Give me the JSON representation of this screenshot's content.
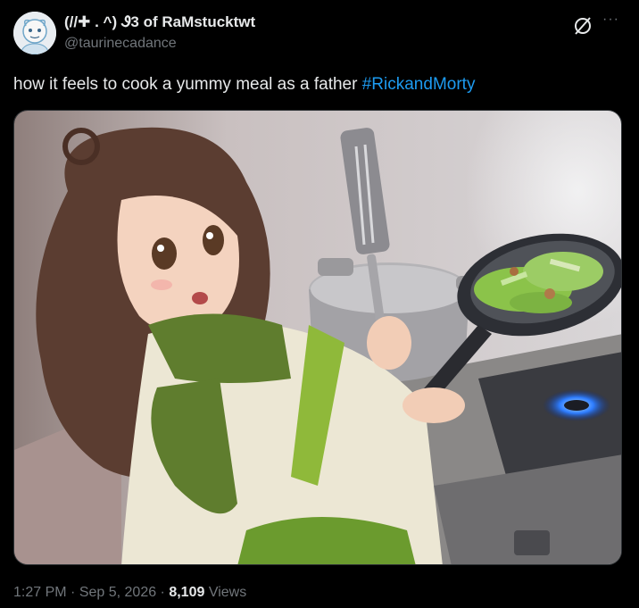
{
  "author": {
    "display_name": "(//✚ . ^) Ꮽ3 of RaMstucktwt",
    "handle": "@taurinecadance"
  },
  "post": {
    "text": "how it feels to cook a yummy meal as a father ",
    "hashtag": "#RickandMorty"
  },
  "footer": {
    "time": "1:27 PM",
    "separator": " · ",
    "date": "Sep 5, 2026",
    "views_count": "8,109",
    "views_label": " Views"
  },
  "icons": {
    "grok": "grok-slash-icon",
    "more": "more-dots-icon"
  },
  "colors": {
    "background": "#000000",
    "text": "#e7e9ea",
    "secondary": "#71767b",
    "accent": "#1d9bf0"
  }
}
